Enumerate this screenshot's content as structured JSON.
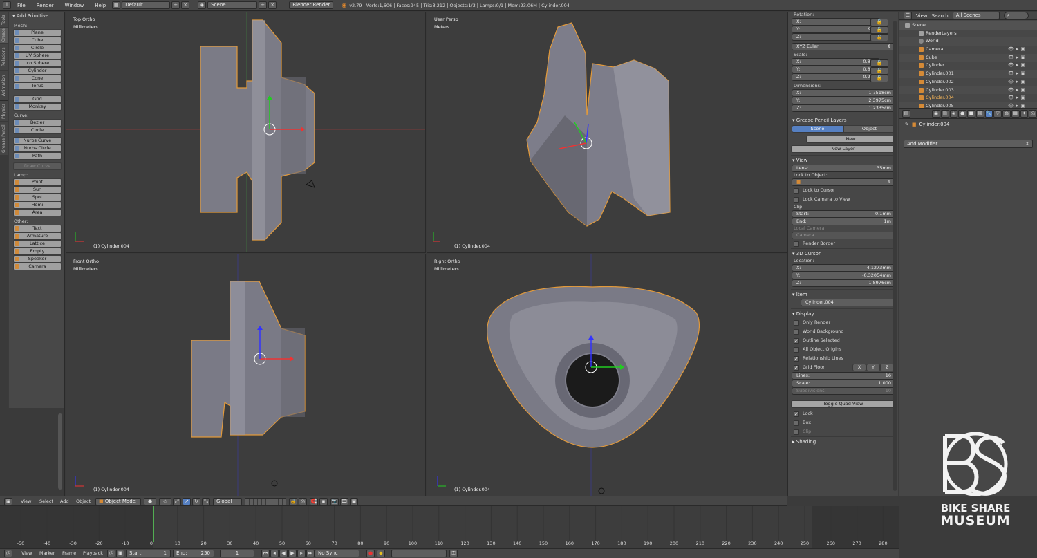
{
  "topbar": {
    "menus": [
      "File",
      "Render",
      "Window",
      "Help"
    ],
    "layout": "Default",
    "scene": "Scene",
    "engine": "Blender Render",
    "stats": "v2.79 | Verts:1,606 | Faces:945 | Tris:3,212 | Objects:1/3 | Lamps:0/1 | Mem:23.06M | Cylinder.004"
  },
  "tabs": [
    "Tools",
    "Create",
    "Relations",
    "Animation",
    "Physics",
    "Grease Pencil"
  ],
  "shelf": {
    "title": "Add Primitive",
    "groups": [
      {
        "label": "Mesh:",
        "items": [
          "Plane",
          "Cube",
          "Circle",
          "UV Sphere",
          "Ico Sphere",
          "Cylinder",
          "Cone",
          "Torus"
        ]
      },
      {
        "label": "",
        "items": [
          "Grid",
          "Monkey"
        ]
      },
      {
        "label": "Curve:",
        "items": [
          "Bezier",
          "Circle"
        ]
      },
      {
        "label": "",
        "items": [
          "Nurbs Curve",
          "Nurbs Circle",
          "Path"
        ]
      },
      {
        "label": "",
        "items": [
          "Draw Curve"
        ]
      },
      {
        "label": "Lamp:",
        "items": [
          "Point",
          "Sun",
          "Spot",
          "Hemi",
          "Area"
        ]
      },
      {
        "label": "Other:",
        "items": [
          "Text",
          "Armature",
          "Lattice",
          "Empty",
          "Speaker",
          "Camera"
        ]
      }
    ]
  },
  "viewports": [
    {
      "title": "Top Ortho",
      "units": "Millimeters",
      "object": "(1) Cylinder.004"
    },
    {
      "title": "User Persp",
      "units": "Meters",
      "object": "(1) Cylinder.004"
    },
    {
      "title": "Front Ortho",
      "units": "Millimeters",
      "object": "(1) Cylinder.004"
    },
    {
      "title": "Right Ortho",
      "units": "Millimeters",
      "object": "(1) Cylinder.004"
    }
  ],
  "props": {
    "rotation_label": "Rotation:",
    "rotation": [
      {
        "k": "X:",
        "v": "0°"
      },
      {
        "k": "Y:",
        "v": "90°"
      },
      {
        "k": "Z:",
        "v": "0°"
      }
    ],
    "rotation_mode": "XYZ Euler",
    "scale_label": "Scale:",
    "scale": [
      {
        "k": "X:",
        "v": "0.889"
      },
      {
        "k": "Y:",
        "v": "0.889"
      },
      {
        "k": "Z:",
        "v": "0.260"
      }
    ],
    "dims_label": "Dimensions:",
    "dims": [
      {
        "k": "X:",
        "v": "1.7518cm"
      },
      {
        "k": "Y:",
        "v": "2.3975cm"
      },
      {
        "k": "Z:",
        "v": "1.2335cm"
      }
    ],
    "gp_title": "Grease Pencil Layers",
    "gp_scene": "Scene",
    "gp_object": "Object",
    "gp_new": "New",
    "gp_new_layer": "New Layer",
    "view_title": "View",
    "lens_k": "Lens:",
    "lens_v": "35mm",
    "lock_obj": "Lock to Object:",
    "lock_cursor": "Lock to Cursor",
    "lock_camera": "Lock Camera to View",
    "clip_label": "Clip:",
    "clip_start_k": "Start:",
    "clip_start_v": "0.1mm",
    "clip_end_k": "End:",
    "clip_end_v": "1m",
    "local_camera": "Local Camera:",
    "camera_field": "Camera",
    "render_border": "Render Border",
    "cursor_title": "3D Cursor",
    "location_label": "Location:",
    "location": [
      {
        "k": "X:",
        "v": "4.1273mm"
      },
      {
        "k": "Y:",
        "v": "-0.32054mm"
      },
      {
        "k": "Z:",
        "v": "1.8976cm"
      }
    ],
    "item_title": "Item",
    "item_name": "Cylinder.004",
    "display_title": "Display",
    "display_checks": [
      "Only Render",
      "World Background",
      "Outline Selected",
      "All Object Origins",
      "Relationship Lines",
      "Grid Floor"
    ],
    "axis_x": "X",
    "axis_y": "Y",
    "axis_z": "Z",
    "lines_k": "Lines:",
    "lines_v": "16",
    "scale_k": "Scale:",
    "scale_v": "1.000",
    "subdiv_k": "Subdivisions:",
    "subdiv_v": "10",
    "toggle_quad": "Toggle Quad View",
    "lock_checks": [
      "Lock",
      "Box",
      "Clip"
    ],
    "shading_title": "Shading"
  },
  "outliner": {
    "menus": [
      "View",
      "Search"
    ],
    "filter": "All Scenes",
    "items": [
      "Scene",
      "RenderLayers",
      "World",
      "Camera",
      "Cube",
      "Cylinder",
      "Cylinder.001",
      "Cylinder.002",
      "Cylinder.003",
      "Cylinder.004",
      "Cylinder.005"
    ]
  },
  "modifiers": {
    "object": "Cylinder.004",
    "add": "Add Modifier"
  },
  "view3d_bar": {
    "menus": [
      "View",
      "Select",
      "Add",
      "Object"
    ],
    "mode": "Object Mode",
    "orientation": "Global"
  },
  "timeline": {
    "ticks": [
      "-50",
      "-40",
      "-30",
      "-20",
      "-10",
      "0",
      "10",
      "20",
      "30",
      "40",
      "50",
      "60",
      "70",
      "80",
      "90",
      "100",
      "110",
      "120",
      "130",
      "140",
      "150",
      "160",
      "170",
      "180",
      "190",
      "200",
      "210",
      "220",
      "230",
      "240",
      "250",
      "260",
      "270",
      "280"
    ],
    "menus": [
      "View",
      "Marker",
      "Frame",
      "Playback"
    ],
    "start_k": "Start:",
    "start_v": "1",
    "end_k": "End:",
    "end_v": "250",
    "current": "1",
    "sync": "No Sync"
  },
  "logo": {
    "line1": "BIKE SHARE",
    "line2": "MUSEUM"
  }
}
